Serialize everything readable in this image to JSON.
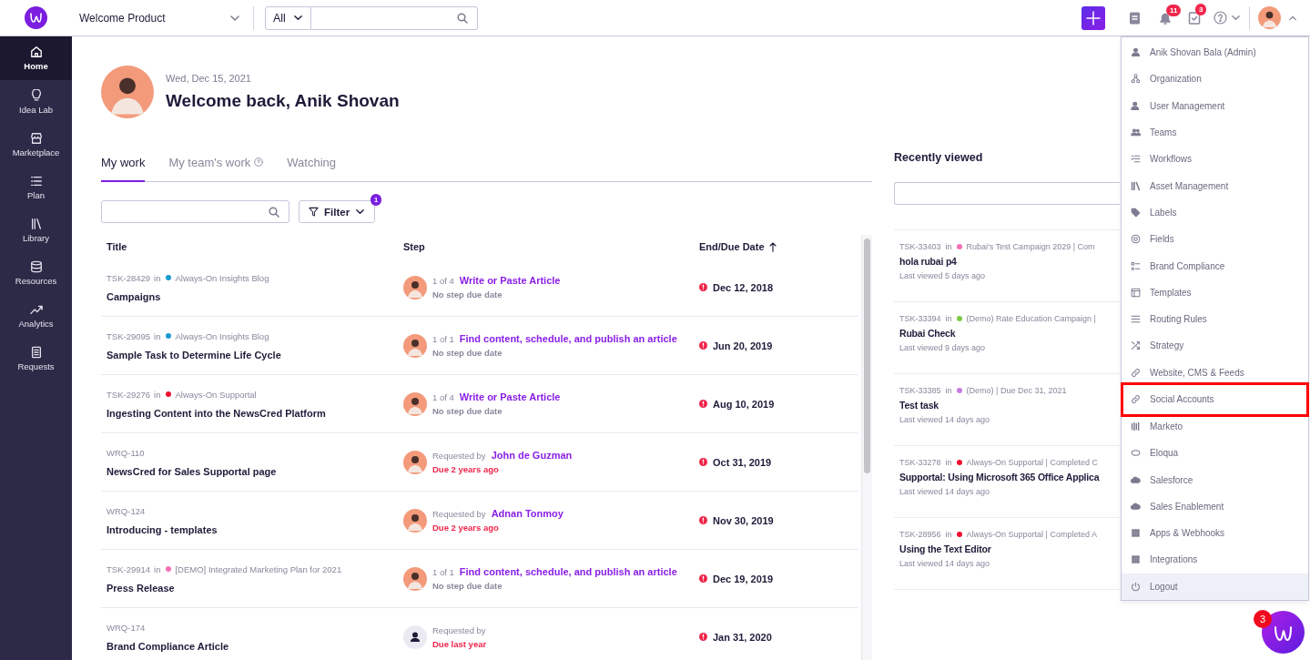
{
  "topbar": {
    "product": "Welcome Product",
    "search_scope": "All",
    "notifications_badge": "11",
    "tasks_badge": "3"
  },
  "sidebar": {
    "items": [
      {
        "label": "Home",
        "selected": true
      },
      {
        "label": "Idea Lab",
        "selected": false
      },
      {
        "label": "Marketplace",
        "selected": false
      },
      {
        "label": "Plan",
        "selected": false
      },
      {
        "label": "Library",
        "selected": false
      },
      {
        "label": "Resources",
        "selected": false
      },
      {
        "label": "Analytics",
        "selected": false
      },
      {
        "label": "Requests",
        "selected": false
      }
    ]
  },
  "header": {
    "date": "Wed, Dec 15, 2021",
    "greeting": "Welcome back, Anik Shovan"
  },
  "tabs": [
    {
      "label": "My work",
      "selected": true,
      "help": false
    },
    {
      "label": "My team's work",
      "selected": false,
      "help": true
    },
    {
      "label": "Watching",
      "selected": false,
      "help": false
    }
  ],
  "filter": {
    "label": "Filter",
    "badge": "1"
  },
  "table": {
    "columns": [
      {
        "label": "Title",
        "sorted": false
      },
      {
        "label": "Step",
        "sorted": false
      },
      {
        "label": "End/Due Date",
        "sorted": true
      }
    ],
    "rows": [
      {
        "kind": "task",
        "id": "TSK-28429",
        "in": "in",
        "project": "Always-On Insights Blog",
        "color": "#1a9bd0",
        "title": "Campaigns",
        "step": {
          "avatar": {
            "kind": "photo"
          },
          "prefix": "1 of 4",
          "link": "Write or Paste Article",
          "note": "No step due date",
          "overdue": false
        },
        "date": "Dec 12, 2018"
      },
      {
        "kind": "task",
        "id": "TSK-29095",
        "in": "in",
        "project": "Always-On Insights Blog",
        "color": "#1a9bd0",
        "title": "Sample Task to Determine Life Cycle",
        "step": {
          "avatar": {
            "kind": "photo"
          },
          "prefix": "1 of 1",
          "link": "Find content, schedule, and publish an article",
          "note": "No step due date",
          "overdue": false
        },
        "date": "Jun 20, 2019"
      },
      {
        "kind": "task",
        "id": "TSK-29276",
        "in": "in",
        "project": "Always-On Supportal",
        "color": "#f0102e",
        "title": "Ingesting Content into the NewsCred Platform",
        "step": {
          "avatar": {
            "kind": "photo"
          },
          "prefix": "1 of 4",
          "link": "Write or Paste Article",
          "note": "No step due date",
          "overdue": false
        },
        "date": "Aug 10, 2019"
      },
      {
        "kind": "request",
        "id": "WRQ-110",
        "title": "NewsCred for Sales Supportal page",
        "step": {
          "avatar": {
            "kind": "photo"
          },
          "prefix": "Requested by",
          "link": "John de Guzman",
          "note": "Due 2 years ago",
          "overdue": true
        },
        "date": "Oct 31, 2019"
      },
      {
        "kind": "request",
        "id": "WRQ-124",
        "title": "Introducing - templates",
        "step": {
          "avatar": {
            "kind": "photo"
          },
          "prefix": "Requested by",
          "link": "Adnan Tonmoy",
          "note": "Due 2 years ago",
          "overdue": true
        },
        "date": "Nov 30, 2019"
      },
      {
        "kind": "task",
        "id": "TSK-29914",
        "in": "in",
        "project": "[DEMO] Integrated Marketing Plan for 2021",
        "color": "#f46fb5",
        "title": "Press Release",
        "step": {
          "avatar": {
            "kind": "photo"
          },
          "prefix": "1 of 1",
          "link": "Find content, schedule, and publish an article",
          "note": "No step due date",
          "overdue": false
        },
        "date": "Dec 19, 2019"
      },
      {
        "kind": "request",
        "id": "WRQ-174",
        "title": "Brand Compliance Article",
        "step": {
          "avatar": {
            "kind": "generic"
          },
          "prefix": "Requested by",
          "note": "Due last year",
          "overdue": true
        },
        "date": "Jan 31, 2020"
      }
    ]
  },
  "recently_viewed": {
    "title": "Recently viewed",
    "items": [
      {
        "id": "TSK-33403",
        "in": "in",
        "color": "#f46fb5",
        "meta": "Rubai's Test Campaign 2029 | Com",
        "title": "hola rubai p4",
        "viewed": "Last viewed 5 days ago"
      },
      {
        "id": "TSK-33394",
        "in": "in",
        "color": "#7ac943",
        "meta": "(Demo) Rate Education Campaign |",
        "title": "Rubai Check",
        "viewed": "Last viewed 9 days ago"
      },
      {
        "id": "TSK-33385",
        "in": "in",
        "color": "#c67be0",
        "meta": "(Demo)  | Due Dec 31, 2021",
        "title": "Test task",
        "viewed": "Last viewed 14 days ago"
      },
      {
        "id": "TSK-33278",
        "in": "in",
        "color": "#f0102e",
        "meta": "Always-On Supportal | Completed C",
        "title": "Supportal: Using Microsoft 365 Office Applica",
        "viewed": "Last viewed 14 days ago"
      },
      {
        "id": "TSK-28956",
        "in": "in",
        "color": "#f0102e",
        "meta": "Always-On Supportal | Completed A",
        "title": "Using the Text Editor",
        "viewed": "Last viewed 14 days ago"
      }
    ]
  },
  "user_menu": {
    "items": [
      {
        "label": "Anik Shovan Bala (Admin)",
        "highlighted": false
      },
      {
        "label": "Organization",
        "highlighted": false
      },
      {
        "label": "User Management",
        "highlighted": false
      },
      {
        "label": "Teams",
        "highlighted": false
      },
      {
        "label": "Workflows",
        "highlighted": false
      },
      {
        "label": "Asset Management",
        "highlighted": false
      },
      {
        "label": "Labels",
        "highlighted": false
      },
      {
        "label": "Fields",
        "highlighted": false
      },
      {
        "label": "Brand Compliance",
        "highlighted": false
      },
      {
        "label": "Templates",
        "highlighted": false
      },
      {
        "label": "Routing Rules",
        "highlighted": false
      },
      {
        "label": "Strategy",
        "highlighted": false
      },
      {
        "label": "Website, CMS & Feeds",
        "highlighted": false
      },
      {
        "label": "Social Accounts",
        "highlighted": true
      },
      {
        "label": "Marketo",
        "highlighted": false
      },
      {
        "label": "Eloqua",
        "highlighted": false
      },
      {
        "label": "Salesforce",
        "highlighted": false
      },
      {
        "label": "Sales Enablement",
        "highlighted": false
      },
      {
        "label": "Apps & Webhooks",
        "highlighted": false
      },
      {
        "label": "Integrations",
        "highlighted": false
      },
      {
        "label": "Logout",
        "highlighted": false
      }
    ]
  },
  "chat": {
    "badge": "3"
  }
}
